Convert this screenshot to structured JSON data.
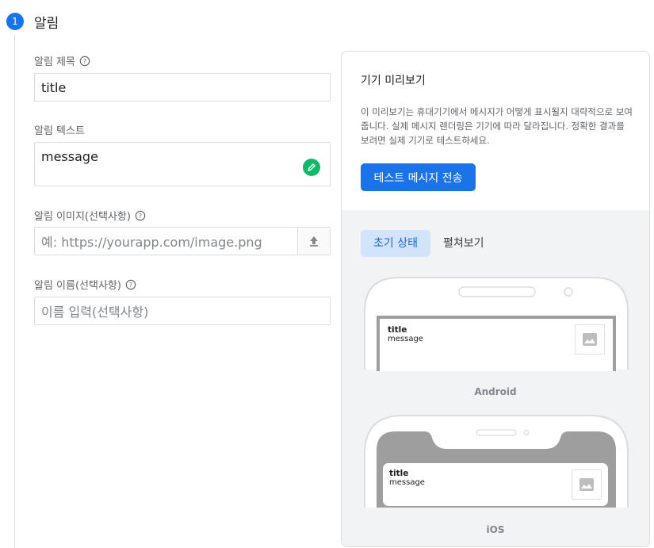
{
  "step": {
    "number": "1",
    "title": "알림"
  },
  "form": {
    "title_label": "알림 제목",
    "title_value": "title",
    "text_label": "알림 텍스트",
    "text_value": "message",
    "image_label": "알림 이미지(선택사항)",
    "image_placeholder": "예: https://yourapp.com/image.png",
    "name_label": "알림 이름(선택사항)",
    "name_placeholder": "이름 입력(선택사항)"
  },
  "preview": {
    "title": "기기 미리보기",
    "description": "이 미리보기는 휴대기기에서 메시지가 어떻게 표시될지 대략적으로 보여줍니다. 실제 메시지 렌더링은 기기에 따라 달라집니다. 정확한 결과를 보려면 실제 기기로 테스트하세요.",
    "send_button": "테스트 메시지 전송",
    "tabs": [
      {
        "label": "초기 상태",
        "active": true
      },
      {
        "label": "펼쳐보기",
        "active": false
      }
    ],
    "android": {
      "label": "Android",
      "notif_title": "title",
      "notif_message": "message"
    },
    "ios": {
      "label": "iOS",
      "notif_title": "title",
      "notif_message": "message"
    }
  },
  "colors": {
    "accent": "#1a73e8",
    "emoji": "#12b76a"
  },
  "icons": [
    "help-icon",
    "emoji-picker-icon",
    "upload-icon",
    "image-icon"
  ]
}
